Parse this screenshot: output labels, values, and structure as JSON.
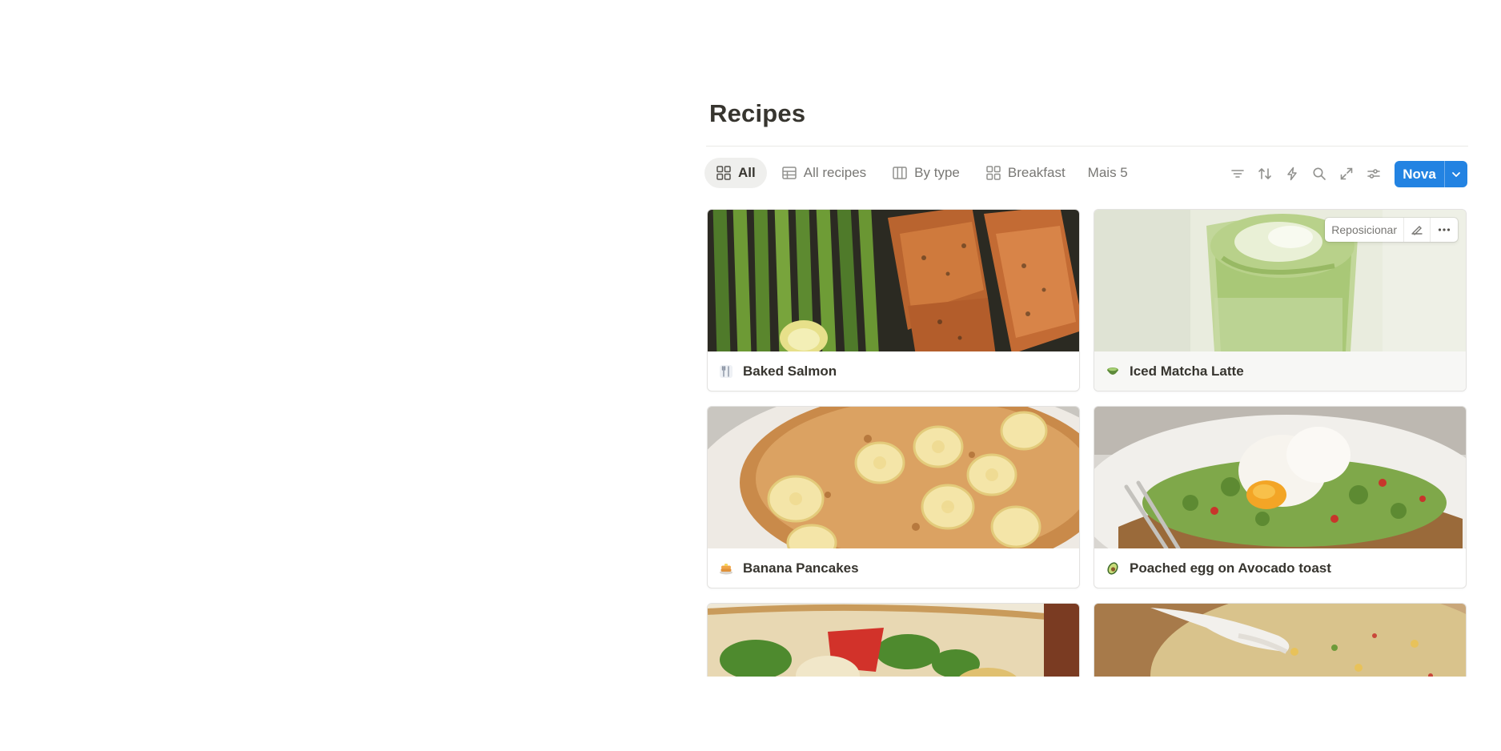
{
  "page": {
    "title": "Recipes"
  },
  "tabs": [
    {
      "label": "All",
      "icon": "gallery-icon",
      "active": true
    },
    {
      "label": "All recipes",
      "icon": "table-icon",
      "active": false
    },
    {
      "label": "By type",
      "icon": "board-icon",
      "active": false
    },
    {
      "label": "Breakfast",
      "icon": "gallery-icon",
      "active": false
    }
  ],
  "more_tabs": "Mais 5",
  "toolbar": {
    "icons": [
      "filter-icon",
      "sort-icon",
      "automation-icon",
      "search-icon",
      "expand-icon",
      "settings-icon"
    ],
    "new_label": "Nova"
  },
  "cover_actions": {
    "reposition_label": "Reposicionar"
  },
  "cards": [
    {
      "title": "Baked Salmon",
      "icon": "fork-knife-icon"
    },
    {
      "title": "Iced Matcha Latte",
      "icon": "matcha-bowl-icon"
    },
    {
      "title": "Banana Pancakes",
      "icon": "pancakes-icon"
    },
    {
      "title": "Poached egg on Avocado toast",
      "icon": "avocado-icon"
    },
    {
      "title": "",
      "icon": ""
    },
    {
      "title": "",
      "icon": ""
    }
  ],
  "colors": {
    "accent": "#2383e2",
    "text": "#37352f",
    "muted": "#787774"
  }
}
